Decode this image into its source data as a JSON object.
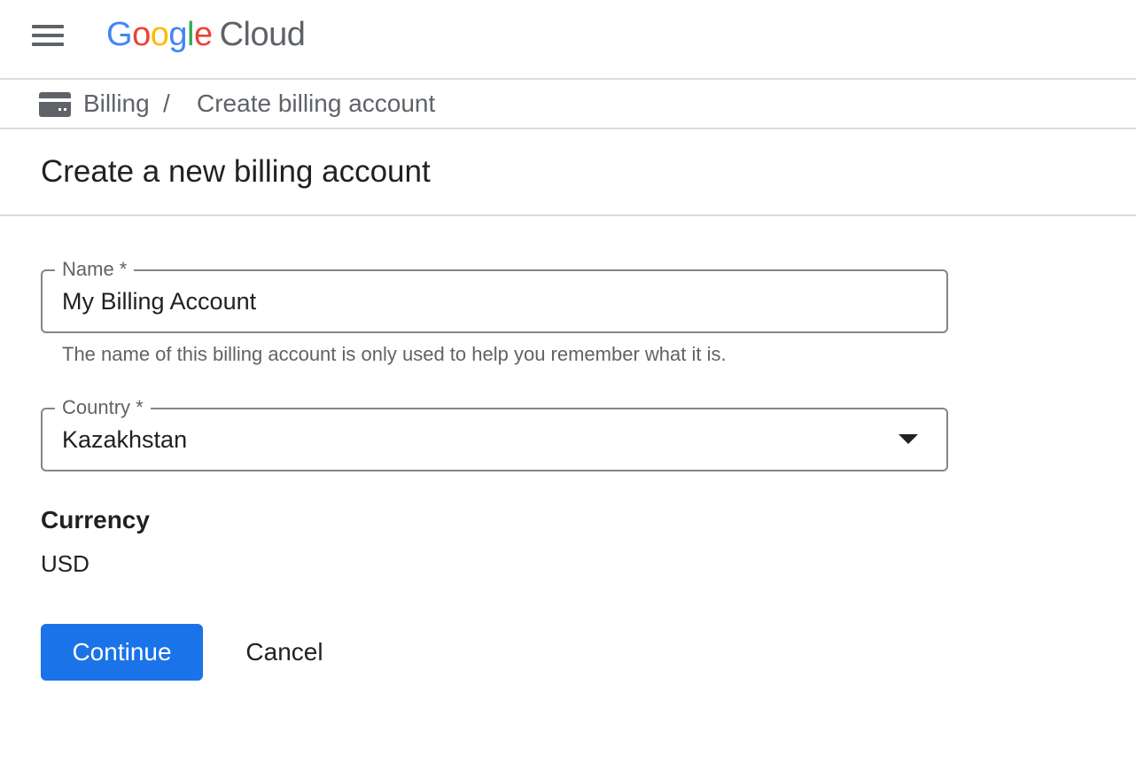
{
  "header": {
    "menu_icon": "hamburger-menu-icon",
    "logo": {
      "letters": [
        "G",
        "o",
        "o",
        "g",
        "l",
        "e"
      ],
      "product": "Cloud"
    }
  },
  "breadcrumb": {
    "icon": "billing-card-icon",
    "items": [
      "Billing",
      "Create billing account"
    ],
    "separator": "/"
  },
  "page": {
    "title": "Create a new billing account"
  },
  "form": {
    "name": {
      "label": "Name *",
      "value": "My Billing Account",
      "hint": "The name of this billing account is only used to help you remember what it is."
    },
    "country": {
      "label": "Country *",
      "value": "Kazakhstan",
      "icon": "dropdown-arrow-icon"
    },
    "currency": {
      "label": "Currency",
      "value": "USD"
    }
  },
  "actions": {
    "continue_label": "Continue",
    "cancel_label": "Cancel"
  },
  "colors": {
    "primary": "#1a73e8",
    "divider": "#dadce0",
    "secondary_text": "#5f6368",
    "outline": "#80868b"
  }
}
